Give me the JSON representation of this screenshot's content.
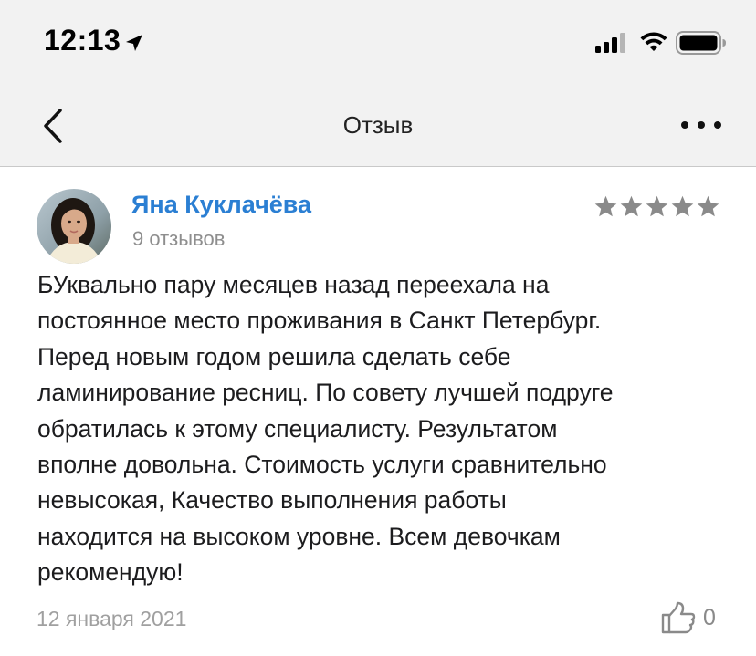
{
  "status_bar": {
    "time": "12:13"
  },
  "nav": {
    "title": "Отзыв"
  },
  "review": {
    "author": "Яна Куклачёва",
    "reviews_count": "9 отзывов",
    "rating": 5,
    "rating_max": 5,
    "star_color": "#8a8a8a",
    "text_lines": [
      "БУквально пару месяцев назад переехала на",
      "постоянное место проживания в Санкт Петербург.",
      "Перед новым годом решила сделать себе",
      "ламинирование ресниц. По совету лучшей подруге",
      "обратилась к этому специалисту. Результатом",
      "вполне довольна. Стоимость услуги сравнительно",
      "невысокая, Качество выполнения работы",
      "находится на высоком уровне. Всем девочкам",
      "рекомендую!"
    ],
    "date": "12 января 2021",
    "likes": "0"
  },
  "colors": {
    "author_link": "#2b7fd3",
    "secondary_text": "#8e8e8e",
    "bar_background": "#f2f2f2"
  },
  "icons": {
    "location": "location-arrow-icon",
    "signal": "cellular-signal-icon",
    "wifi": "wifi-icon",
    "battery": "battery-icon",
    "back": "chevron-left-icon",
    "more": "more-dots-icon",
    "like": "thumbs-up-icon"
  }
}
